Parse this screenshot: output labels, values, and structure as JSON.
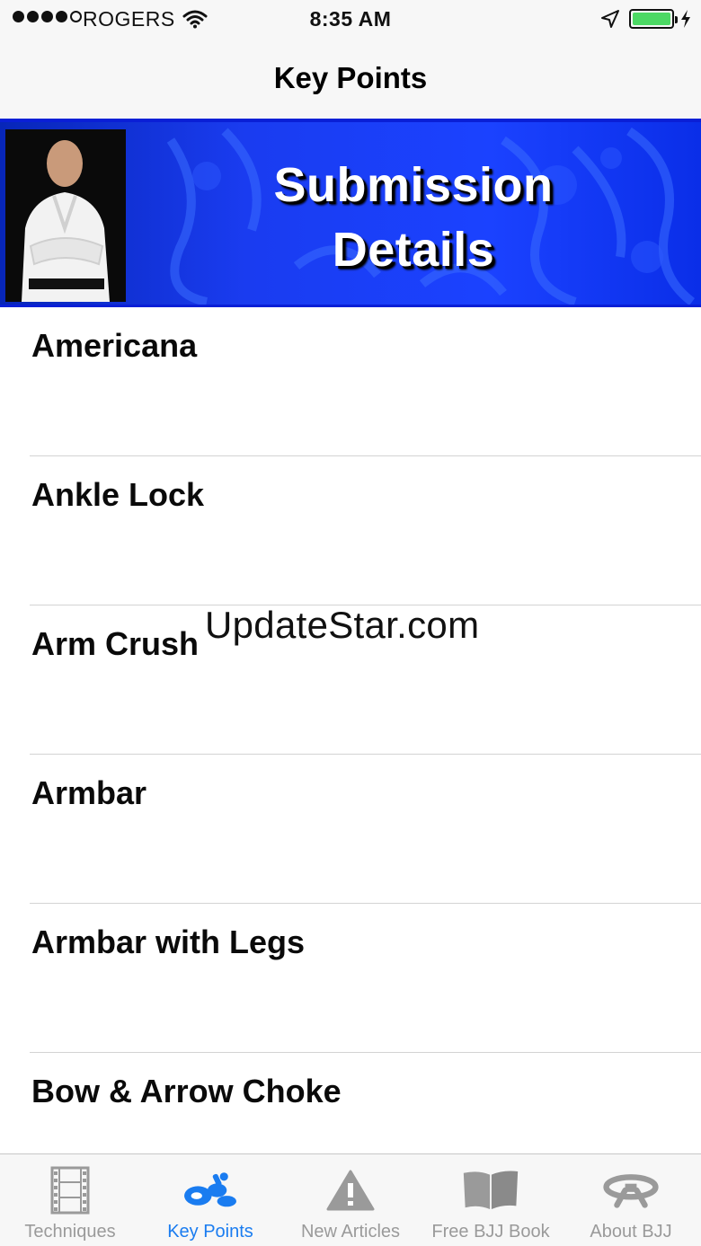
{
  "status_bar": {
    "carrier": "ROGERS",
    "time": "8:35 AM",
    "battery_color": "#4cd964"
  },
  "nav": {
    "title": "Key Points"
  },
  "banner": {
    "line1": "Submission",
    "line2": "Details",
    "background_color": "#1a3cf0"
  },
  "list": {
    "items": [
      {
        "label": "Americana"
      },
      {
        "label": "Ankle Lock"
      },
      {
        "label": "Arm Crush"
      },
      {
        "label": "Armbar"
      },
      {
        "label": "Armbar with Legs"
      },
      {
        "label": "Bow & Arrow Choke"
      }
    ]
  },
  "watermark": "UpdateStar.com",
  "tab_bar": {
    "active_color": "#1a7cf0",
    "inactive_color": "#9a9a9a",
    "tabs": [
      {
        "label": "Techniques",
        "icon": "film-icon"
      },
      {
        "label": "Key Points",
        "icon": "key-points-icon"
      },
      {
        "label": "New Articles",
        "icon": "warning-icon"
      },
      {
        "label": "Free BJJ Book",
        "icon": "book-icon"
      },
      {
        "label": "About BJJ",
        "icon": "belt-icon"
      }
    ]
  }
}
